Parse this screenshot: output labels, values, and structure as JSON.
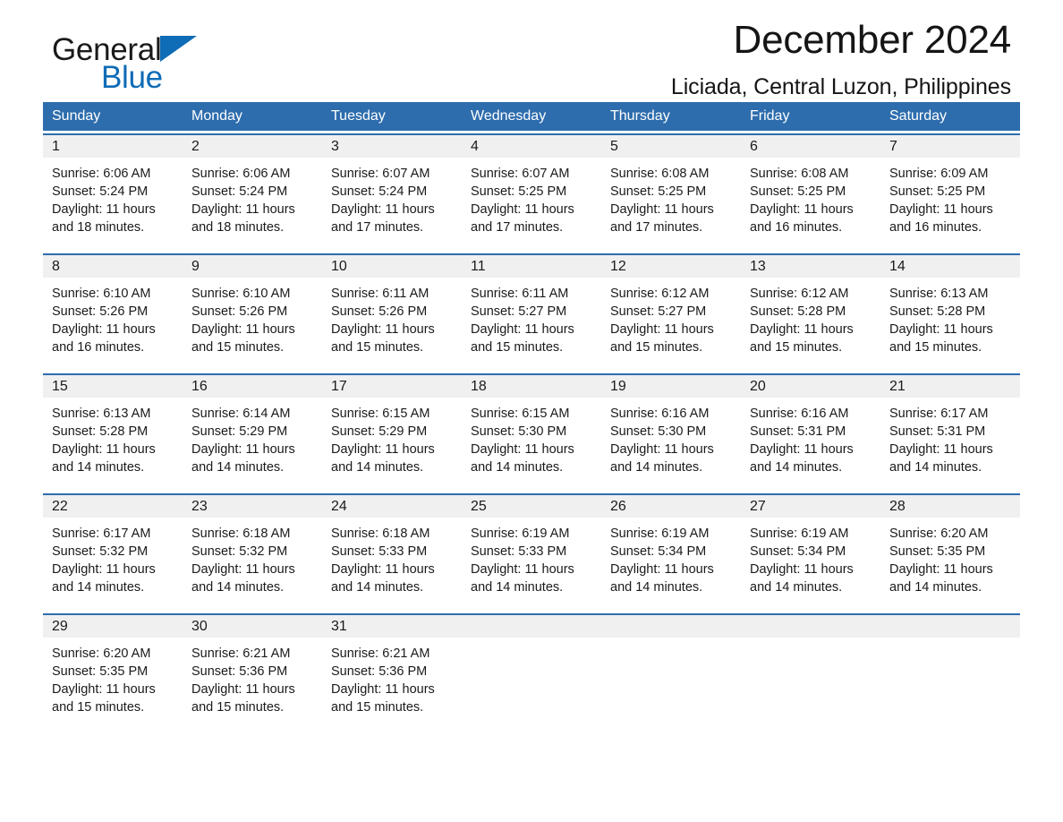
{
  "brand": {
    "name_part1": "General",
    "name_part2": "Blue",
    "triangle_icon": "triangle-icon",
    "accent_color": "#0f6cb6"
  },
  "header": {
    "title": "December 2024",
    "location": "Liciada, Central Luzon, Philippines"
  },
  "colors": {
    "header_blue": "#2E6DAD",
    "day_band_gray": "#F0F0F0",
    "text": "#1a1a1a"
  },
  "calendar": {
    "weekday_headers": [
      "Sunday",
      "Monday",
      "Tuesday",
      "Wednesday",
      "Thursday",
      "Friday",
      "Saturday"
    ],
    "weeks": [
      [
        {
          "day": "1",
          "sunrise": "Sunrise: 6:06 AM",
          "sunset": "Sunset: 5:24 PM",
          "daylight_line1": "Daylight: 11 hours",
          "daylight_line2": "and 18 minutes."
        },
        {
          "day": "2",
          "sunrise": "Sunrise: 6:06 AM",
          "sunset": "Sunset: 5:24 PM",
          "daylight_line1": "Daylight: 11 hours",
          "daylight_line2": "and 18 minutes."
        },
        {
          "day": "3",
          "sunrise": "Sunrise: 6:07 AM",
          "sunset": "Sunset: 5:24 PM",
          "daylight_line1": "Daylight: 11 hours",
          "daylight_line2": "and 17 minutes."
        },
        {
          "day": "4",
          "sunrise": "Sunrise: 6:07 AM",
          "sunset": "Sunset: 5:25 PM",
          "daylight_line1": "Daylight: 11 hours",
          "daylight_line2": "and 17 minutes."
        },
        {
          "day": "5",
          "sunrise": "Sunrise: 6:08 AM",
          "sunset": "Sunset: 5:25 PM",
          "daylight_line1": "Daylight: 11 hours",
          "daylight_line2": "and 17 minutes."
        },
        {
          "day": "6",
          "sunrise": "Sunrise: 6:08 AM",
          "sunset": "Sunset: 5:25 PM",
          "daylight_line1": "Daylight: 11 hours",
          "daylight_line2": "and 16 minutes."
        },
        {
          "day": "7",
          "sunrise": "Sunrise: 6:09 AM",
          "sunset": "Sunset: 5:25 PM",
          "daylight_line1": "Daylight: 11 hours",
          "daylight_line2": "and 16 minutes."
        }
      ],
      [
        {
          "day": "8",
          "sunrise": "Sunrise: 6:10 AM",
          "sunset": "Sunset: 5:26 PM",
          "daylight_line1": "Daylight: 11 hours",
          "daylight_line2": "and 16 minutes."
        },
        {
          "day": "9",
          "sunrise": "Sunrise: 6:10 AM",
          "sunset": "Sunset: 5:26 PM",
          "daylight_line1": "Daylight: 11 hours",
          "daylight_line2": "and 15 minutes."
        },
        {
          "day": "10",
          "sunrise": "Sunrise: 6:11 AM",
          "sunset": "Sunset: 5:26 PM",
          "daylight_line1": "Daylight: 11 hours",
          "daylight_line2": "and 15 minutes."
        },
        {
          "day": "11",
          "sunrise": "Sunrise: 6:11 AM",
          "sunset": "Sunset: 5:27 PM",
          "daylight_line1": "Daylight: 11 hours",
          "daylight_line2": "and 15 minutes."
        },
        {
          "day": "12",
          "sunrise": "Sunrise: 6:12 AM",
          "sunset": "Sunset: 5:27 PM",
          "daylight_line1": "Daylight: 11 hours",
          "daylight_line2": "and 15 minutes."
        },
        {
          "day": "13",
          "sunrise": "Sunrise: 6:12 AM",
          "sunset": "Sunset: 5:28 PM",
          "daylight_line1": "Daylight: 11 hours",
          "daylight_line2": "and 15 minutes."
        },
        {
          "day": "14",
          "sunrise": "Sunrise: 6:13 AM",
          "sunset": "Sunset: 5:28 PM",
          "daylight_line1": "Daylight: 11 hours",
          "daylight_line2": "and 15 minutes."
        }
      ],
      [
        {
          "day": "15",
          "sunrise": "Sunrise: 6:13 AM",
          "sunset": "Sunset: 5:28 PM",
          "daylight_line1": "Daylight: 11 hours",
          "daylight_line2": "and 14 minutes."
        },
        {
          "day": "16",
          "sunrise": "Sunrise: 6:14 AM",
          "sunset": "Sunset: 5:29 PM",
          "daylight_line1": "Daylight: 11 hours",
          "daylight_line2": "and 14 minutes."
        },
        {
          "day": "17",
          "sunrise": "Sunrise: 6:15 AM",
          "sunset": "Sunset: 5:29 PM",
          "daylight_line1": "Daylight: 11 hours",
          "daylight_line2": "and 14 minutes."
        },
        {
          "day": "18",
          "sunrise": "Sunrise: 6:15 AM",
          "sunset": "Sunset: 5:30 PM",
          "daylight_line1": "Daylight: 11 hours",
          "daylight_line2": "and 14 minutes."
        },
        {
          "day": "19",
          "sunrise": "Sunrise: 6:16 AM",
          "sunset": "Sunset: 5:30 PM",
          "daylight_line1": "Daylight: 11 hours",
          "daylight_line2": "and 14 minutes."
        },
        {
          "day": "20",
          "sunrise": "Sunrise: 6:16 AM",
          "sunset": "Sunset: 5:31 PM",
          "daylight_line1": "Daylight: 11 hours",
          "daylight_line2": "and 14 minutes."
        },
        {
          "day": "21",
          "sunrise": "Sunrise: 6:17 AM",
          "sunset": "Sunset: 5:31 PM",
          "daylight_line1": "Daylight: 11 hours",
          "daylight_line2": "and 14 minutes."
        }
      ],
      [
        {
          "day": "22",
          "sunrise": "Sunrise: 6:17 AM",
          "sunset": "Sunset: 5:32 PM",
          "daylight_line1": "Daylight: 11 hours",
          "daylight_line2": "and 14 minutes."
        },
        {
          "day": "23",
          "sunrise": "Sunrise: 6:18 AM",
          "sunset": "Sunset: 5:32 PM",
          "daylight_line1": "Daylight: 11 hours",
          "daylight_line2": "and 14 minutes."
        },
        {
          "day": "24",
          "sunrise": "Sunrise: 6:18 AM",
          "sunset": "Sunset: 5:33 PM",
          "daylight_line1": "Daylight: 11 hours",
          "daylight_line2": "and 14 minutes."
        },
        {
          "day": "25",
          "sunrise": "Sunrise: 6:19 AM",
          "sunset": "Sunset: 5:33 PM",
          "daylight_line1": "Daylight: 11 hours",
          "daylight_line2": "and 14 minutes."
        },
        {
          "day": "26",
          "sunrise": "Sunrise: 6:19 AM",
          "sunset": "Sunset: 5:34 PM",
          "daylight_line1": "Daylight: 11 hours",
          "daylight_line2": "and 14 minutes."
        },
        {
          "day": "27",
          "sunrise": "Sunrise: 6:19 AM",
          "sunset": "Sunset: 5:34 PM",
          "daylight_line1": "Daylight: 11 hours",
          "daylight_line2": "and 14 minutes."
        },
        {
          "day": "28",
          "sunrise": "Sunrise: 6:20 AM",
          "sunset": "Sunset: 5:35 PM",
          "daylight_line1": "Daylight: 11 hours",
          "daylight_line2": "and 14 minutes."
        }
      ],
      [
        {
          "day": "29",
          "sunrise": "Sunrise: 6:20 AM",
          "sunset": "Sunset: 5:35 PM",
          "daylight_line1": "Daylight: 11 hours",
          "daylight_line2": "and 15 minutes."
        },
        {
          "day": "30",
          "sunrise": "Sunrise: 6:21 AM",
          "sunset": "Sunset: 5:36 PM",
          "daylight_line1": "Daylight: 11 hours",
          "daylight_line2": "and 15 minutes."
        },
        {
          "day": "31",
          "sunrise": "Sunrise: 6:21 AM",
          "sunset": "Sunset: 5:36 PM",
          "daylight_line1": "Daylight: 11 hours",
          "daylight_line2": "and 15 minutes."
        },
        {
          "day": "",
          "sunrise": "",
          "sunset": "",
          "daylight_line1": "",
          "daylight_line2": ""
        },
        {
          "day": "",
          "sunrise": "",
          "sunset": "",
          "daylight_line1": "",
          "daylight_line2": ""
        },
        {
          "day": "",
          "sunrise": "",
          "sunset": "",
          "daylight_line1": "",
          "daylight_line2": ""
        },
        {
          "day": "",
          "sunrise": "",
          "sunset": "",
          "daylight_line1": "",
          "daylight_line2": ""
        }
      ]
    ]
  }
}
